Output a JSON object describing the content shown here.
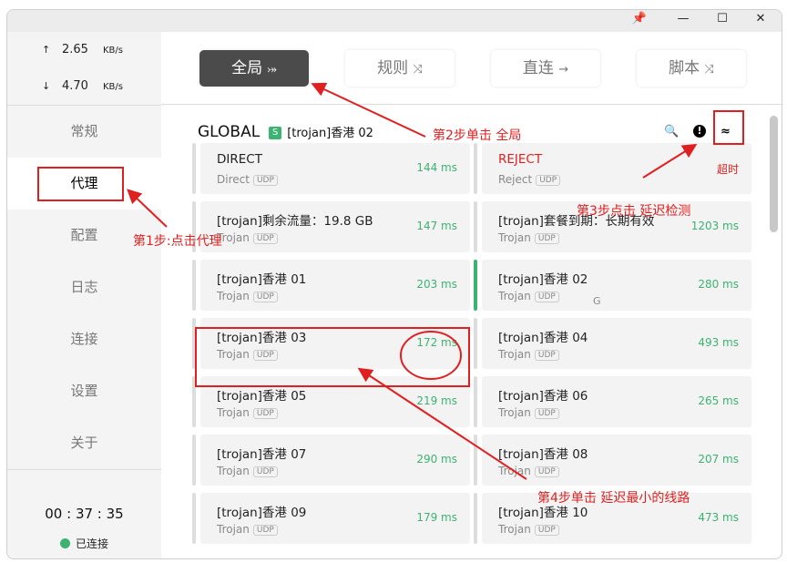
{
  "window": {
    "pin_icon": "pin",
    "minimize_icon": "minimize",
    "maximize_icon": "maximize",
    "close_icon": "close"
  },
  "sidebar": {
    "upload": {
      "arrow": "↑",
      "value": "2.65",
      "unit": "KB/s"
    },
    "download": {
      "arrow": "↓",
      "value": "4.70",
      "unit": "KB/s"
    },
    "items": [
      {
        "label": "常规"
      },
      {
        "label": "代理"
      },
      {
        "label": "配置"
      },
      {
        "label": "日志"
      },
      {
        "label": "连接"
      },
      {
        "label": "设置"
      },
      {
        "label": "关于"
      }
    ],
    "active": 1,
    "timer": "00 : 37 : 35",
    "status": "已连接",
    "status_color": "#3cb371"
  },
  "modes": [
    {
      "label": "全局",
      "icon": "⤖"
    },
    {
      "label": "规则",
      "icon": "⤨"
    },
    {
      "label": "直连",
      "icon": "→"
    },
    {
      "label": "脚本",
      "icon": "⤨"
    }
  ],
  "group": {
    "name": "GLOBAL",
    "badge": "S",
    "selected": "[trojan]香港 02"
  },
  "side_mark": "G",
  "proxies": [
    {
      "name": "DIRECT",
      "type": "Direct",
      "udp": "UDP",
      "delay": "144 ms"
    },
    {
      "name": "REJECT",
      "type": "Reject",
      "udp": "UDP",
      "delay": "超时",
      "red": true
    },
    {
      "name": "[trojan]剩余流量：19.8 GB",
      "type": "Trojan",
      "udp": "UDP",
      "delay": "147 ms"
    },
    {
      "name": "[trojan]套餐到期：长期有效",
      "type": "Trojan",
      "udp": "UDP",
      "delay": "1203 ms"
    },
    {
      "name": "[trojan]香港 01",
      "type": "Trojan",
      "udp": "UDP",
      "delay": "203 ms"
    },
    {
      "name": "[trojan]香港 02",
      "type": "Trojan",
      "udp": "UDP",
      "delay": "280 ms",
      "selected": true
    },
    {
      "name": "[trojan]香港 03",
      "type": "Trojan",
      "udp": "UDP",
      "delay": "172 ms"
    },
    {
      "name": "[trojan]香港 04",
      "type": "Trojan",
      "udp": "UDP",
      "delay": "493 ms"
    },
    {
      "name": "[trojan]香港 05",
      "type": "Trojan",
      "udp": "UDP",
      "delay": "219 ms"
    },
    {
      "name": "[trojan]香港 06",
      "type": "Trojan",
      "udp": "UDP",
      "delay": "265 ms"
    },
    {
      "name": "[trojan]香港 07",
      "type": "Trojan",
      "udp": "UDP",
      "delay": "290 ms"
    },
    {
      "name": "[trojan]香港 08",
      "type": "Trojan",
      "udp": "UDP",
      "delay": "207 ms"
    },
    {
      "name": "[trojan]香港 09",
      "type": "Trojan",
      "udp": "UDP",
      "delay": "179 ms"
    },
    {
      "name": "[trojan]香港 10",
      "type": "Trojan",
      "udp": "UDP",
      "delay": "473 ms"
    }
  ],
  "annotations": {
    "step1": "第1步:点击代理",
    "step2": "第2步单击 全局",
    "step3": "第3步点击 延迟检测",
    "step4": "第4步单击 延迟最小的线路"
  },
  "colors": {
    "accent": "#3cb371",
    "annotation": "#e02020"
  }
}
